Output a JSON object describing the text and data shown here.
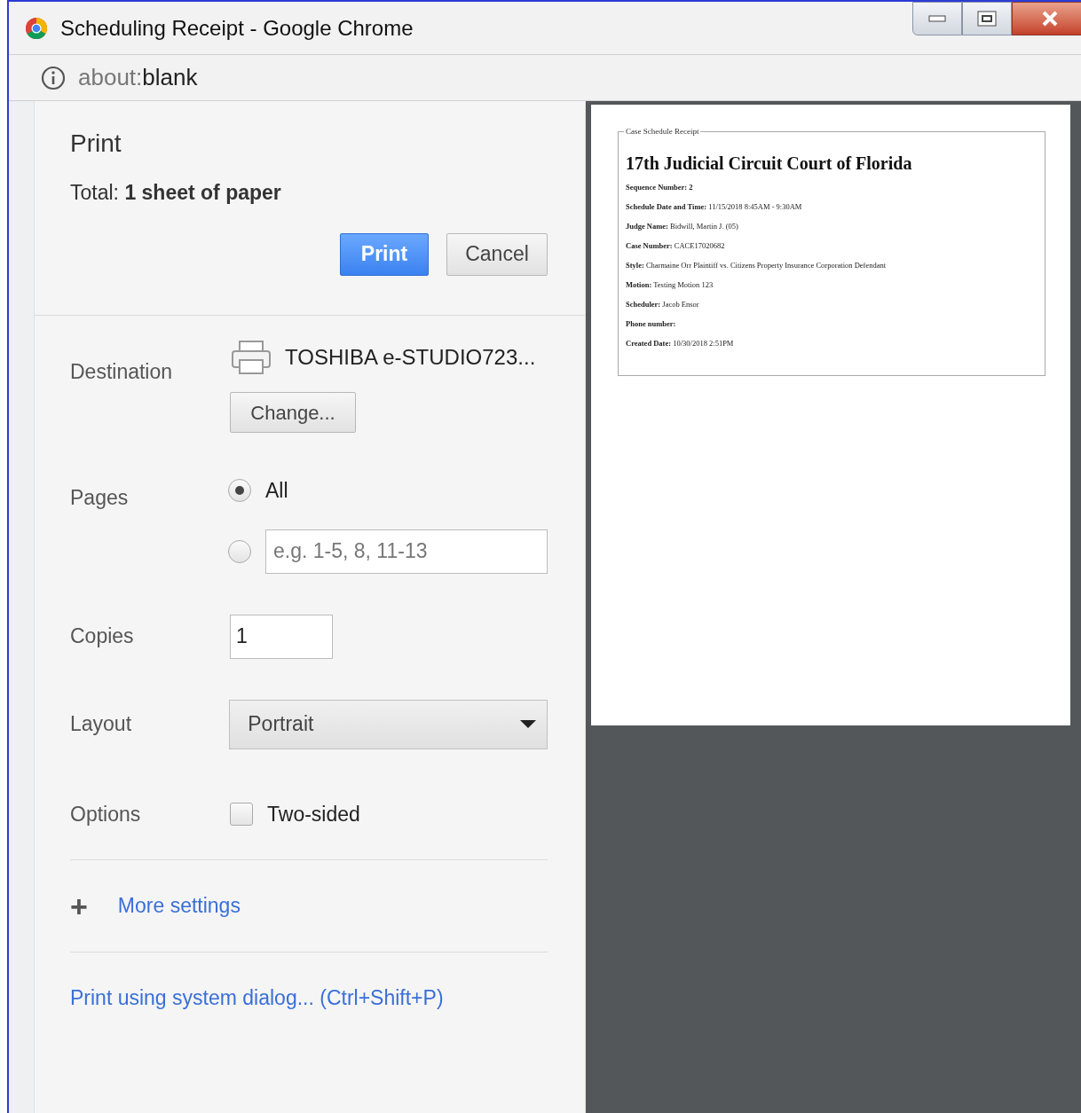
{
  "window": {
    "title": "Scheduling Receipt - Google Chrome"
  },
  "address_bar": {
    "scheme": "about:",
    "rest": "blank"
  },
  "print": {
    "title": "Print",
    "total_label": "Total:",
    "total_value": "1 sheet of paper",
    "buttons": [
      {
        "label": "Print",
        "kind": "primary"
      },
      {
        "label": "Cancel",
        "kind": "secondary"
      }
    ]
  },
  "destination": {
    "label": "Destination",
    "printer": "TOSHIBA e-STUDIO723...",
    "change": "Change..."
  },
  "pages": {
    "label": "Pages",
    "options": [
      {
        "kind": "all",
        "label": "All",
        "selected": true
      },
      {
        "kind": "custom",
        "placeholder": "e.g. 1-5, 8, 11-13",
        "selected": false
      }
    ]
  },
  "copies": {
    "label": "Copies",
    "value": "1"
  },
  "layout": {
    "label": "Layout",
    "value": "Portrait"
  },
  "options": {
    "label": "Options",
    "items": [
      {
        "label": "Two-sided",
        "checked": false
      }
    ]
  },
  "more_settings": {
    "icon": "+",
    "label": "More settings"
  },
  "system_dialog": "Print using system dialog... (Ctrl+Shift+P)",
  "preview": {
    "legend": "Case Schedule Receipt",
    "heading": "17th Judicial Circuit Court of Florida",
    "fields": [
      {
        "label": "Sequence Number: 2"
      },
      {
        "label": "Schedule Date and Time:",
        "value": "11/15/2018 8:45AM - 9:30AM"
      },
      {
        "label": "Judge Name:",
        "value": "Bidwill, Martin J. (05)"
      },
      {
        "label": "Case Number:",
        "value": "CACE17020682"
      },
      {
        "label": "Style:",
        "value": "Charmaine Orr Plaintiff vs. Citizens Property Insurance Corporation Defendant"
      },
      {
        "label": "Motion:",
        "value": "Testing Motion 123"
      },
      {
        "label": "Scheduler:",
        "value": "Jacob Ensor"
      },
      {
        "label": "Phone number:"
      },
      {
        "label": "Created Date:",
        "value": "10/30/2018 2:51PM"
      }
    ]
  }
}
